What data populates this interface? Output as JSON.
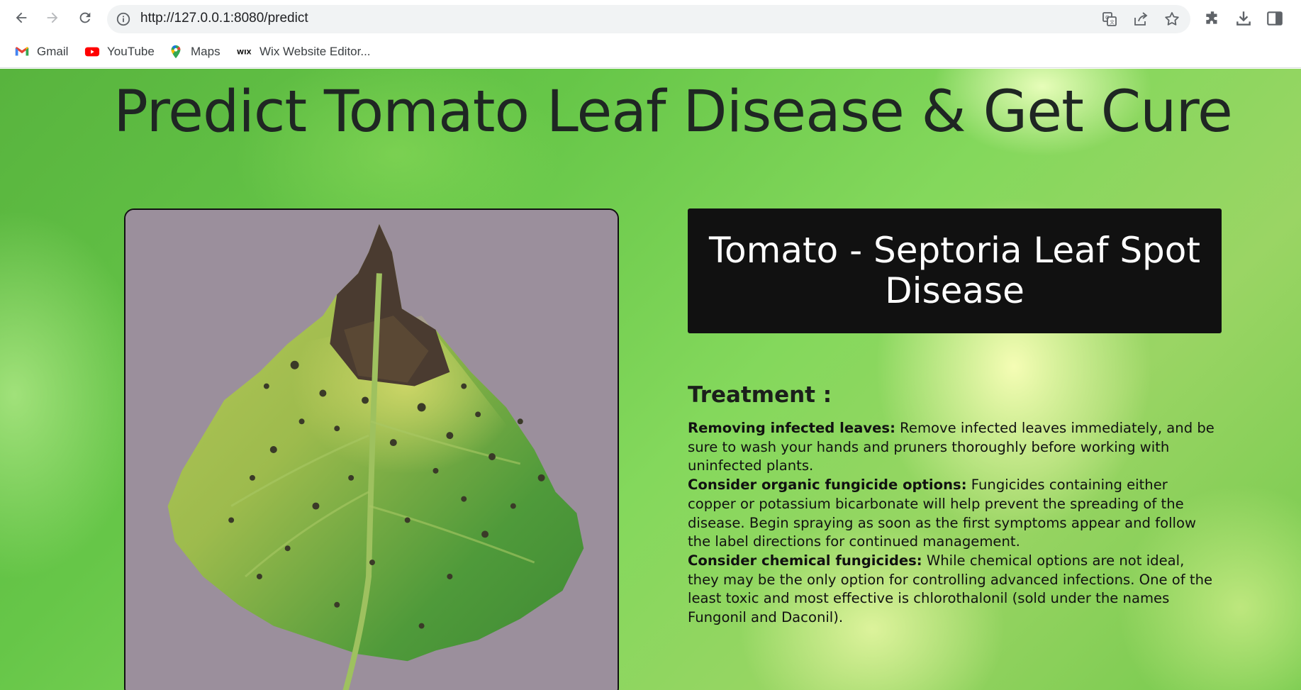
{
  "browser": {
    "url": "http://127.0.0.1:8080/predict",
    "icons": [
      "back-arrow-icon",
      "forward-arrow-icon",
      "reload-icon",
      "site-info-icon",
      "translate-icon",
      "share-icon",
      "bookmark-star-icon",
      "extensions-icon",
      "download-icon",
      "side-panel-icon"
    ],
    "bookmarks": [
      {
        "label": "Gmail",
        "icon": "gmail-icon"
      },
      {
        "label": "YouTube",
        "icon": "youtube-icon"
      },
      {
        "label": "Maps",
        "icon": "maps-icon"
      },
      {
        "label": "Wix Website Editor...",
        "icon": "wix-icon"
      }
    ]
  },
  "page": {
    "title": "Predict Tomato Leaf Disease & Get Cure",
    "result": "Tomato - Septoria Leaf Spot Disease",
    "treatment_heading": "Treatment :",
    "treatments": [
      {
        "label": "Removing infected leaves:",
        "text": "Remove infected leaves immediately, and be sure to wash your hands and pruners thoroughly before working with uninfected plants."
      },
      {
        "label": "Consider organic fungicide options:",
        "text": "Fungicides containing either copper or potassium bicarbonate will help prevent the spreading of the disease. Begin spraying as soon as the first symptoms appear and follow the label directions for continued management."
      },
      {
        "label": "Consider chemical fungicides:",
        "text": "While chemical options are not ideal, they may be the only option for controlling advanced infections. One of the least toxic and most effective is chlorothalonil (sold under the names Fungonil and Daconil)."
      }
    ],
    "colors": {
      "background": "#6cc84a",
      "result_bg": "#111111",
      "title_text": "#1f2623"
    }
  }
}
